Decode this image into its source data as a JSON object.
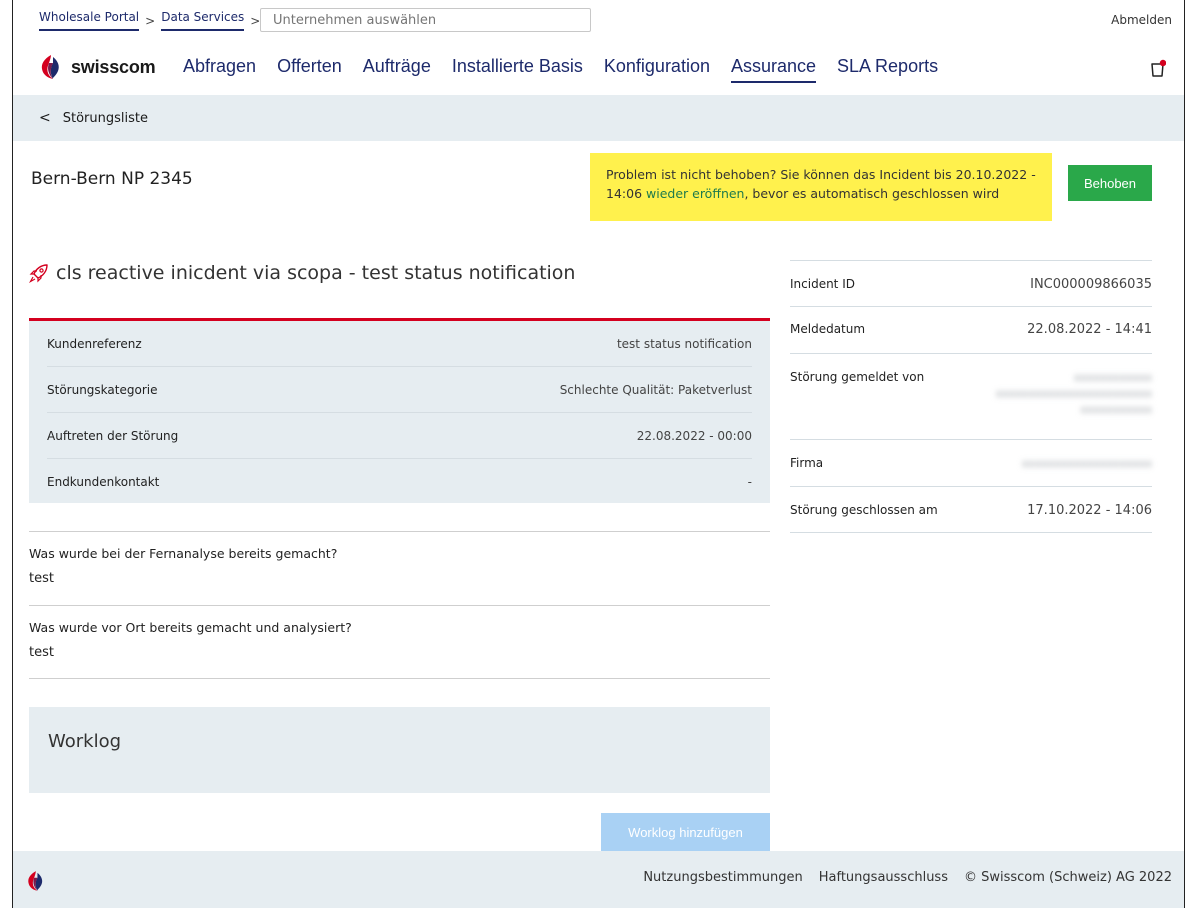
{
  "topbar": {
    "breadcrumbs": [
      "Wholesale Portal",
      "Data Services"
    ],
    "company_placeholder": "Unternehmen auswählen",
    "logout": "Abmelden"
  },
  "brand": {
    "name": "swisscom",
    "colors": {
      "red": "#d4001f",
      "navy": "#1d2a6b"
    }
  },
  "nav": {
    "items": [
      "Abfragen",
      "Offerten",
      "Aufträge",
      "Installierte Basis",
      "Konfiguration",
      "Assurance",
      "SLA Reports"
    ],
    "active": "Assurance",
    "cart_icon": "cart-icon"
  },
  "subheader": {
    "back_label": "Störungsliste"
  },
  "page": {
    "service_title": "Bern-Bern NP 2345",
    "notice_pre": "Problem ist nicht behoben? Sie können das Incident bis 20.10.2022 - 14:06 ",
    "notice_link": "wieder eröffnen",
    "notice_post": ", bevor es automatisch geschlossen wird",
    "fixed_button": "Behoben",
    "incident_title": "cls reactive inicdent via scopa - test status notification"
  },
  "details": [
    {
      "label": "Kundenreferenz",
      "value": "test status notification"
    },
    {
      "label": "Störungskategorie",
      "value": "Schlechte Qualität: Paketverlust"
    },
    {
      "label": "Auftreten der Störung",
      "value": "22.08.2022 - 00:00"
    },
    {
      "label": "Endkundenkontakt",
      "value": "-"
    }
  ],
  "questions": [
    {
      "q": "Was wurde bei der Fernanalyse bereits gemacht?",
      "a": "test"
    },
    {
      "q": "Was wurde vor Ort bereits gemacht und analysiert?",
      "a": "test"
    }
  ],
  "worklog": {
    "title": "Worklog",
    "add_button": "Worklog hinzufügen"
  },
  "meta": [
    {
      "label": "Incident ID",
      "value": "INC000009866035"
    },
    {
      "label": "Meldedatum",
      "value": "22.08.2022 - 14:41"
    },
    {
      "label": "Störung gemeldet von",
      "value": ""
    },
    {
      "label": "Firma",
      "value": ""
    },
    {
      "label": "Störung geschlossen am",
      "value": "17.10.2022 - 14:06"
    }
  ],
  "footer": {
    "links": [
      "Nutzungsbestimmungen",
      "Haftungsausschluss",
      "© Swisscom (Schweiz) AG 2022"
    ]
  }
}
